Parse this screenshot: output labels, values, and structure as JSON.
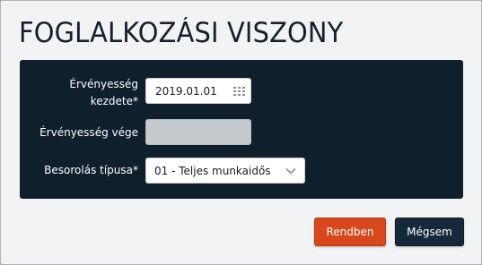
{
  "dialog": {
    "title": "FOGLALKOZÁSI VISZONY"
  },
  "form": {
    "valid_from": {
      "label_line1": "Érvényesség",
      "label_line2": "kezdete*",
      "value": "2019.01.01",
      "icon": "calendar-icon"
    },
    "valid_to": {
      "label": "Érvényesség vége",
      "value": ""
    },
    "classification_type": {
      "label": "Besorolás típusa*",
      "selected": "01 - Teljes munkaidős",
      "icon": "chevron-down-icon"
    }
  },
  "footer": {
    "ok_label": "Rendben",
    "cancel_label": "Mégsem"
  },
  "colors": {
    "panel_bg": "#0f1f2c",
    "primary_button": "#d9481c",
    "secondary_button": "#16293a"
  }
}
